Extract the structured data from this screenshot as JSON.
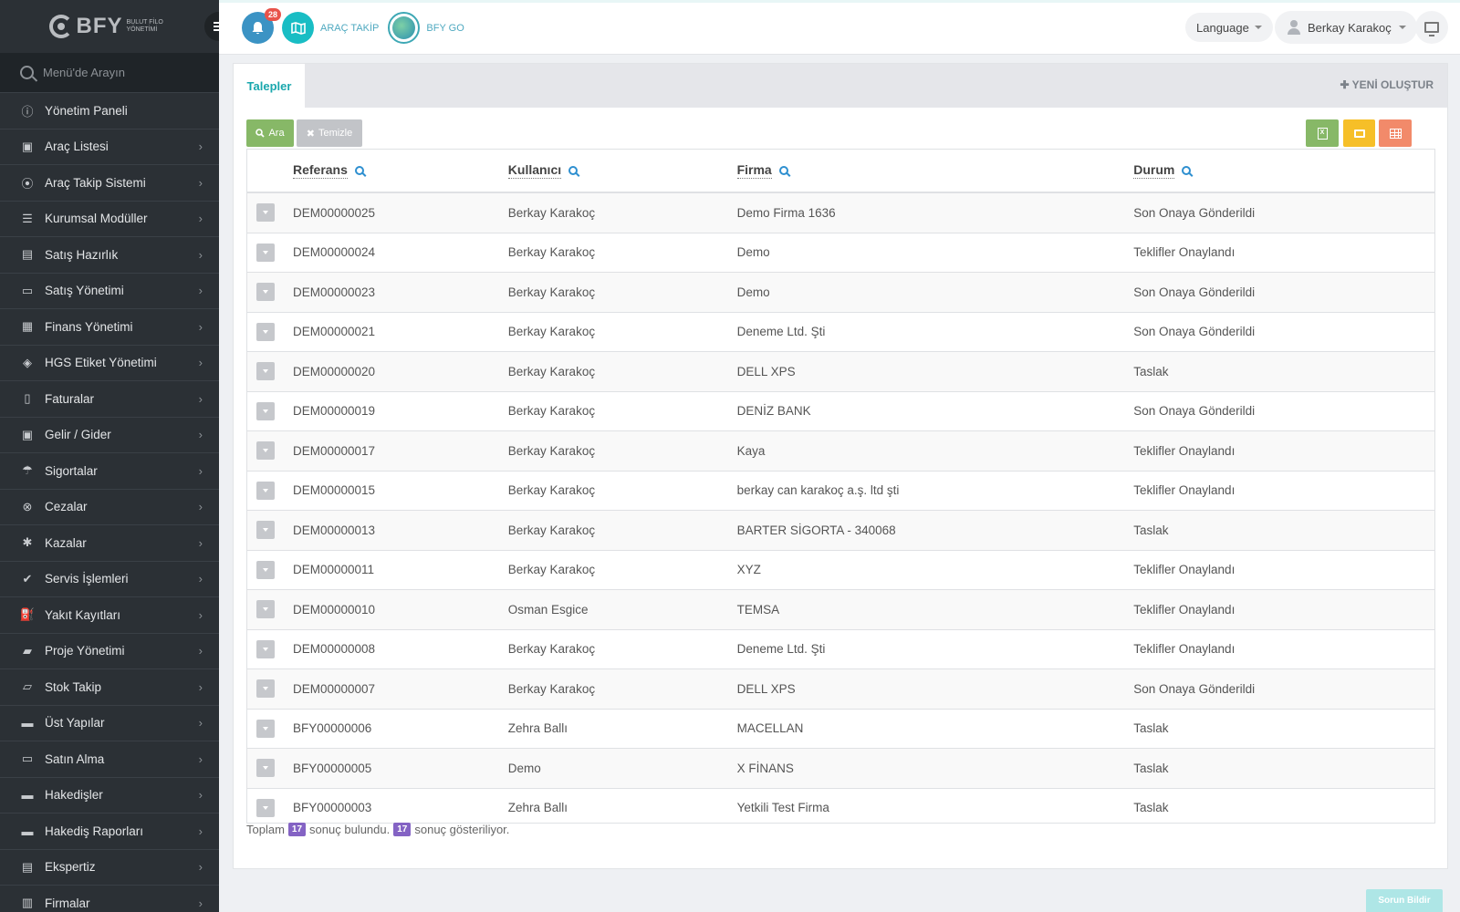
{
  "brand": {
    "name": "BFY",
    "subtitle": "BULUT FİLO YÖNETİMİ"
  },
  "sidebar": {
    "search_placeholder": "Menü'de Arayın",
    "items": [
      {
        "label": "Yönetim Paneli",
        "icon": "info-icon",
        "glyph": "ⓘ",
        "chevron": false
      },
      {
        "label": "Araç Listesi",
        "icon": "bus-icon",
        "glyph": "▣",
        "chevron": true
      },
      {
        "label": "Araç Takip Sistemi",
        "icon": "map-pin-icon",
        "glyph": "⦿",
        "chevron": true
      },
      {
        "label": "Kurumsal Modüller",
        "icon": "server-icon",
        "glyph": "☰",
        "chevron": true
      },
      {
        "label": "Satış Hazırlık",
        "icon": "book-icon",
        "glyph": "▤",
        "chevron": true
      },
      {
        "label": "Satış Yönetimi",
        "icon": "hdd-icon",
        "glyph": "▭",
        "chevron": true
      },
      {
        "label": "Finans Yönetimi",
        "icon": "money-icon",
        "glyph": "▦",
        "chevron": true
      },
      {
        "label": "HGS Etiket Yönetimi",
        "icon": "tag-icon",
        "glyph": "◈",
        "chevron": true
      },
      {
        "label": "Faturalar",
        "icon": "file-icon",
        "glyph": "▯",
        "chevron": true
      },
      {
        "label": "Gelir / Gider",
        "icon": "cash-icon",
        "glyph": "▣",
        "chevron": true
      },
      {
        "label": "Sigortalar",
        "icon": "umbrella-icon",
        "glyph": "☂",
        "chevron": true
      },
      {
        "label": "Cezalar",
        "icon": "times-circle-icon",
        "glyph": "⊗",
        "chevron": true
      },
      {
        "label": "Kazalar",
        "icon": "car-crash-icon",
        "glyph": "✱",
        "chevron": true
      },
      {
        "label": "Servis İşlemleri",
        "icon": "check-circle-icon",
        "glyph": "✔",
        "chevron": true
      },
      {
        "label": "Yakıt Kayıtları",
        "icon": "fuel-icon",
        "glyph": "⛽",
        "chevron": true
      },
      {
        "label": "Proje Yönetimi",
        "icon": "briefcase-icon",
        "glyph": "▰",
        "chevron": true
      },
      {
        "label": "Stok Takip",
        "icon": "inbox-icon",
        "glyph": "▱",
        "chevron": true
      },
      {
        "label": "Üst Yapılar",
        "icon": "truck-icon",
        "glyph": "▬",
        "chevron": true
      },
      {
        "label": "Satın Alma",
        "icon": "credit-card-icon",
        "glyph": "▭",
        "chevron": true
      },
      {
        "label": "Hakedişler",
        "icon": "truck-icon",
        "glyph": "▬",
        "chevron": true
      },
      {
        "label": "Hakediş Raporları",
        "icon": "truck-icon",
        "glyph": "▬",
        "chevron": true
      },
      {
        "label": "Ekspertiz",
        "icon": "list-alt-icon",
        "glyph": "▤",
        "chevron": true
      },
      {
        "label": "Firmalar",
        "icon": "building-icon",
        "glyph": "▥",
        "chevron": true
      }
    ]
  },
  "topbar": {
    "notification_count": "28",
    "arac_takip_label": "ARAÇ TAKİP",
    "bfy_go_label": "BFY GO",
    "language_label": "Language",
    "user_name": "Berkay Karakoç"
  },
  "main": {
    "tab_label": "Talepler",
    "new_button_label": "YENİ OLUŞTUR",
    "search_button_label": "Ara",
    "clear_button_label": "Temizle",
    "columns": [
      "Referans",
      "Kullanıcı",
      "Firma",
      "Durum"
    ],
    "rows": [
      [
        "DEM00000025",
        "Berkay Karakoç",
        "Demo Firma 1636",
        "Son Onaya Gönderildi"
      ],
      [
        "DEM00000024",
        "Berkay Karakoç",
        "Demo",
        "Teklifler Onaylandı"
      ],
      [
        "DEM00000023",
        "Berkay Karakoç",
        "Demo",
        "Son Onaya Gönderildi"
      ],
      [
        "DEM00000021",
        "Berkay Karakoç",
        "Deneme Ltd. Şti",
        "Son Onaya Gönderildi"
      ],
      [
        "DEM00000020",
        "Berkay Karakoç",
        "DELL XPS",
        "Taslak"
      ],
      [
        "DEM00000019",
        "Berkay Karakoç",
        "DENİZ BANK",
        "Son Onaya Gönderildi"
      ],
      [
        "DEM00000017",
        "Berkay Karakoç",
        "Kaya",
        "Teklifler Onaylandı"
      ],
      [
        "DEM00000015",
        "Berkay Karakoç",
        "berkay can karakoç a.ş. ltd şti",
        "Teklifler Onaylandı"
      ],
      [
        "DEM00000013",
        "Berkay Karakoç",
        "BARTER SİGORTA - 340068",
        "Taslak"
      ],
      [
        "DEM00000011",
        "Berkay Karakoç",
        "XYZ",
        "Teklifler Onaylandı"
      ],
      [
        "DEM00000010",
        "Osman Esgice",
        "TEMSA",
        "Teklifler Onaylandı"
      ],
      [
        "DEM00000008",
        "Berkay Karakoç",
        "Deneme Ltd. Şti",
        "Teklifler Onaylandı"
      ],
      [
        "DEM00000007",
        "Berkay Karakoç",
        "DELL XPS",
        "Son Onaya Gönderildi"
      ],
      [
        "BFY00000006",
        "Zehra Ballı",
        "MACELLAN",
        "Taslak"
      ],
      [
        "BFY00000005",
        "Demo",
        "X FİNANS",
        "Taslak"
      ],
      [
        "BFY00000003",
        "Zehra Ballı",
        "Yetkili Test Firma",
        "Taslak"
      ]
    ],
    "footer": {
      "prefix": "Toplam",
      "found_count": "17",
      "found_text": "sonuç bulundu.",
      "shown_count": "17",
      "shown_text": "sonuç gösteriliyor."
    }
  },
  "report_button_label": "Sorun Bildir"
}
